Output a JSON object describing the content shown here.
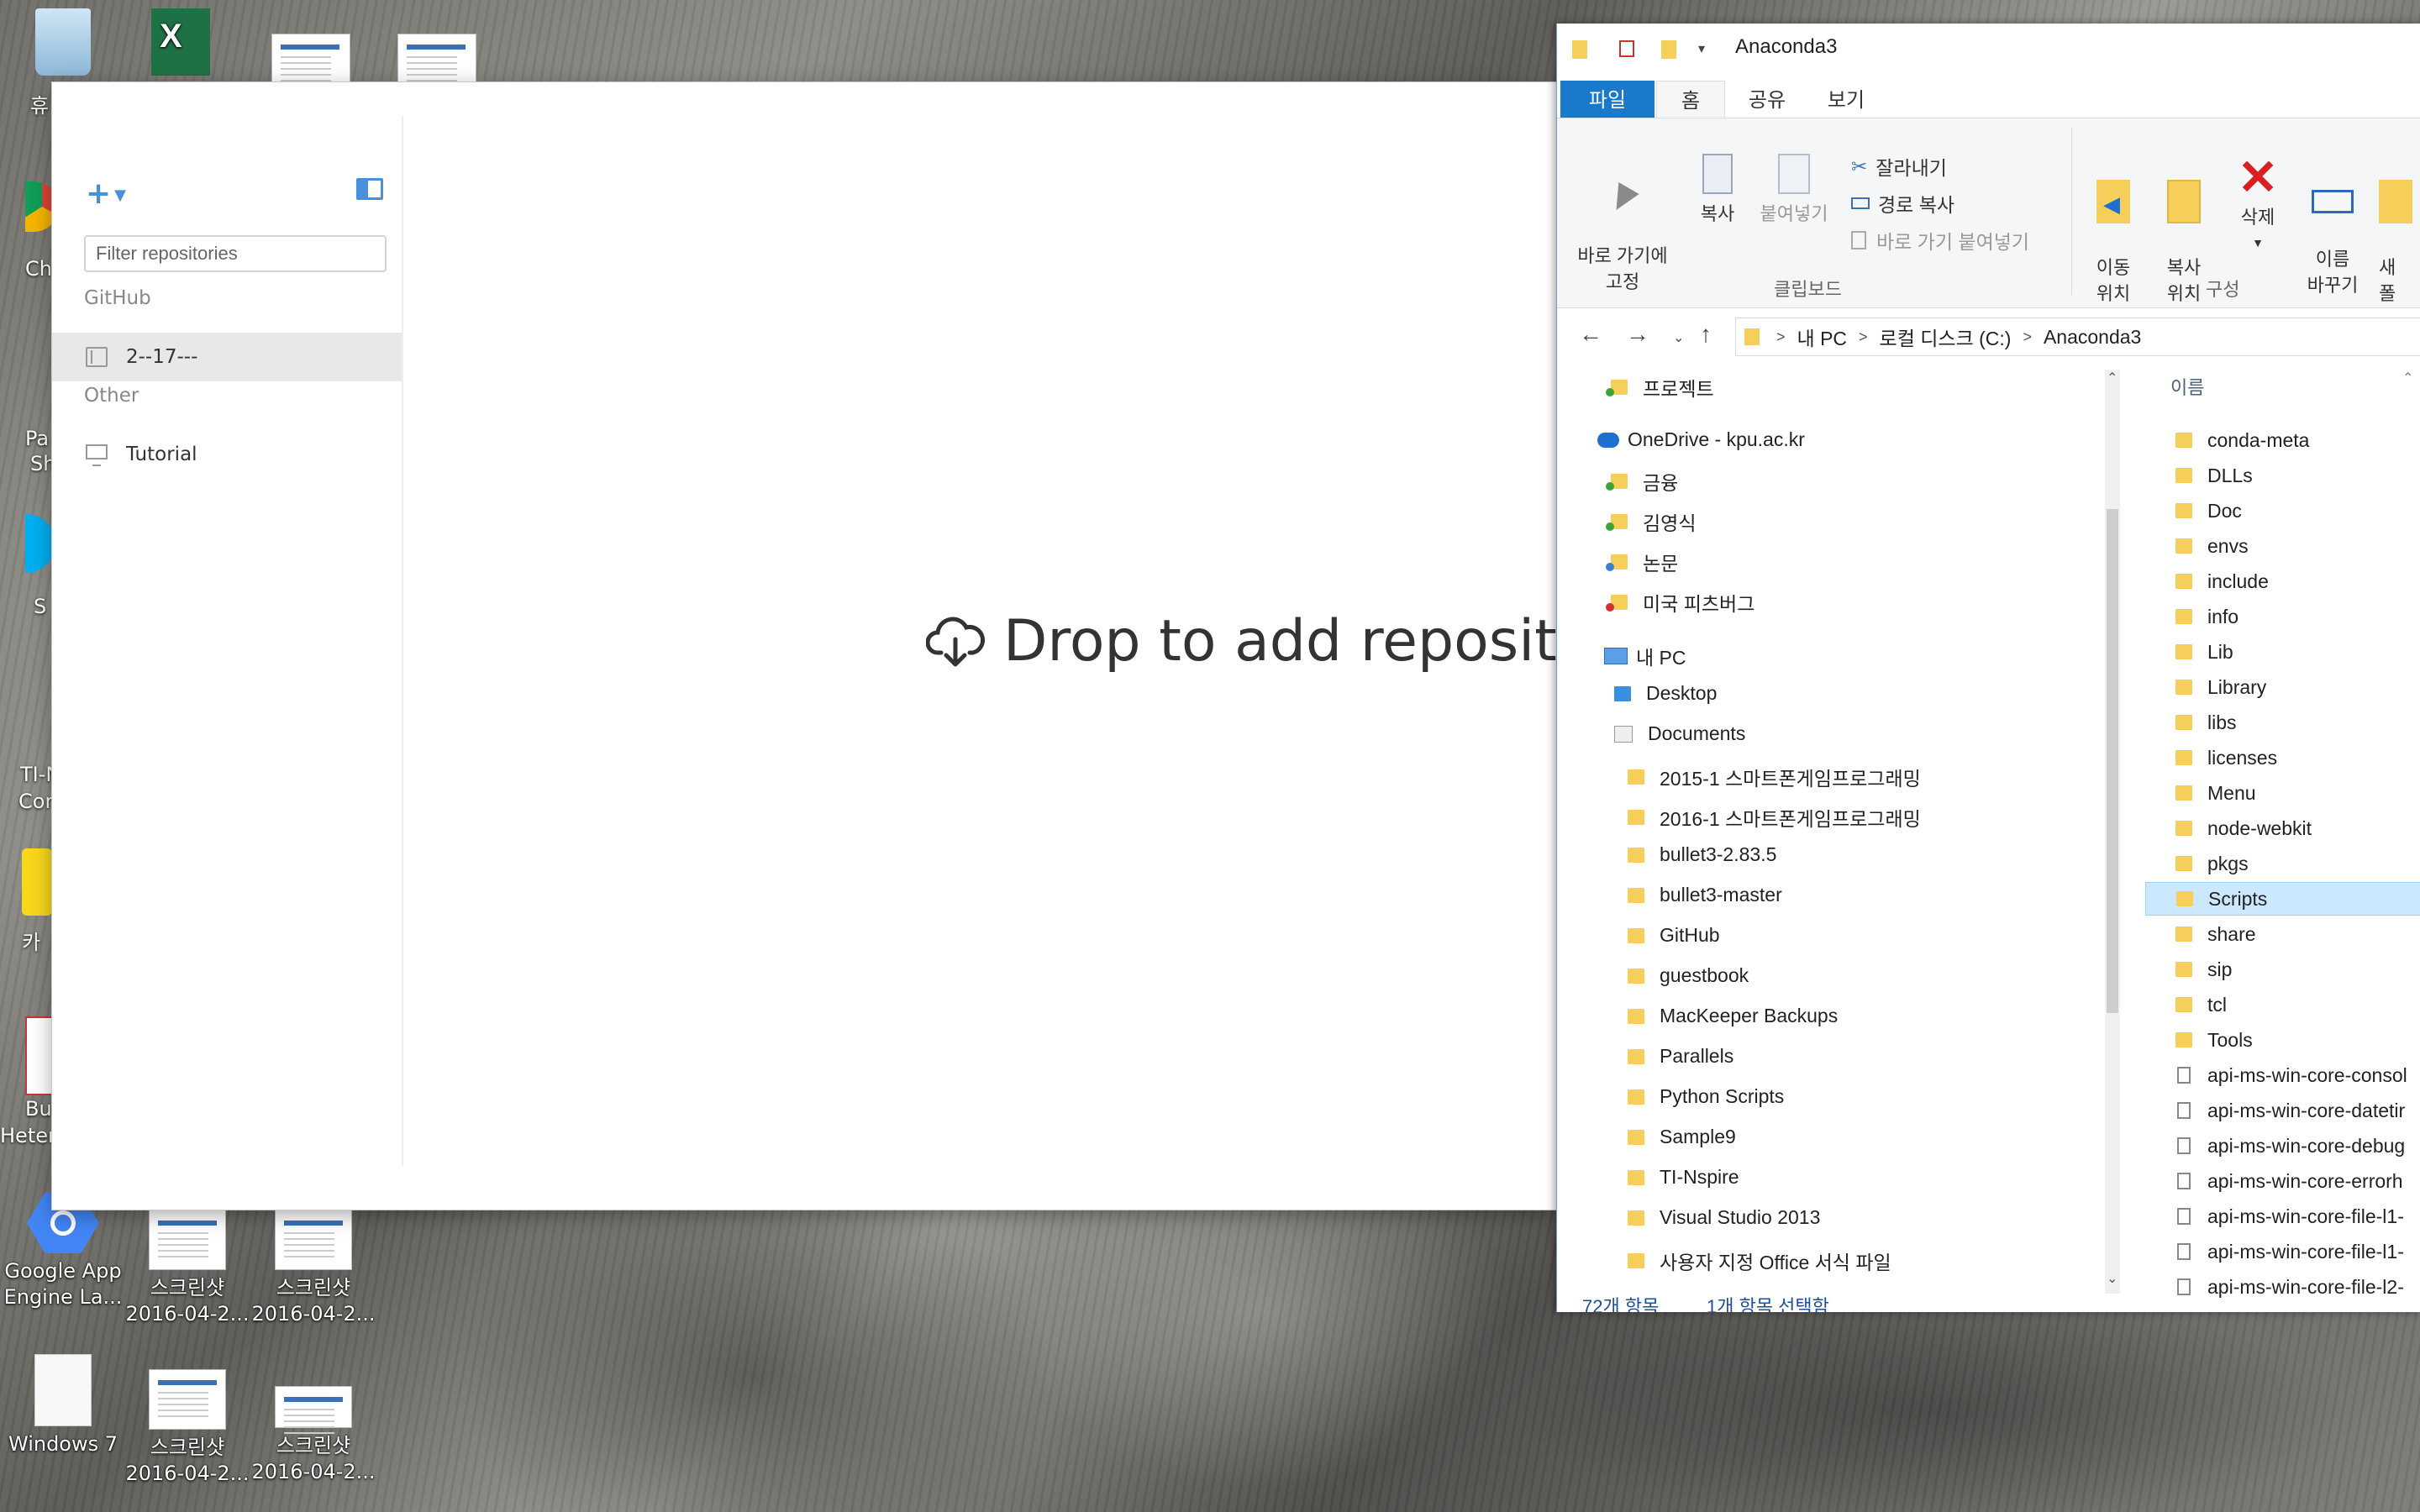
{
  "desktop": {
    "icons": [
      {
        "label": "Google App Engine La..."
      },
      {
        "label": "스크린샷 2016-04-2..."
      },
      {
        "label": "스크린샷 2016-04-2..."
      },
      {
        "label": "Windows 7"
      },
      {
        "label": "스크린샷 2016-04-2..."
      },
      {
        "label": "스크린샷 2016-04-2..."
      }
    ],
    "left_clipped_labels": [
      "휴",
      "Ch",
      "Pa",
      "Sh",
      "S",
      "TI-N",
      "Cor",
      "카",
      "Bu",
      "Heter"
    ]
  },
  "github": {
    "filter_placeholder": "Filter repositories",
    "sections": [
      {
        "title": "GitHub",
        "items": [
          {
            "label": "2--17---",
            "selected": true
          }
        ]
      },
      {
        "title": "Other",
        "items": [
          {
            "label": "Tutorial",
            "selected": false
          }
        ]
      }
    ],
    "drop_text": "Drop to add repositor"
  },
  "explorer": {
    "title": "Anaconda3",
    "tabs": [
      "파일",
      "홈",
      "공유",
      "보기"
    ],
    "ribbon": {
      "pin": "바로 가기에\n고정",
      "copy": "복사",
      "paste": "붙여넣기",
      "cut": "잘라내기",
      "copy_path": "경로 복사",
      "paste_shortcut": "바로 가기 붙여넣기",
      "group_clipboard": "클립보드",
      "move_to": "이동\n위치",
      "copy_to": "복사\n위치",
      "delete": "삭제",
      "rename": "이름\n바꾸기",
      "group_organize": "구성",
      "new_folder_clip": "새\n폴"
    },
    "path": [
      "내 PC",
      "로컬 디스크 (C:)",
      "Anaconda3"
    ],
    "nav_tree": [
      {
        "label": "프로젝트",
        "level": 1,
        "status": "g"
      },
      {
        "label": "OneDrive - kpu.ac.kr",
        "level": 0,
        "icon": "cloud"
      },
      {
        "label": "금융",
        "level": 1,
        "status": "g"
      },
      {
        "label": "김영식",
        "level": 1,
        "status": "g"
      },
      {
        "label": "논문",
        "level": 1,
        "status": "b"
      },
      {
        "label": "미국 피츠버그",
        "level": 1,
        "status": "r"
      },
      {
        "label": "내 PC",
        "level": 0,
        "icon": "pc"
      },
      {
        "label": "Desktop",
        "level": 1,
        "icon": "blue"
      },
      {
        "label": "Documents",
        "level": 1
      },
      {
        "label": "2015-1 스마트폰게임프로그래밍",
        "level": 2
      },
      {
        "label": "2016-1 스마트폰게임프로그래밍",
        "level": 2
      },
      {
        "label": "bullet3-2.83.5",
        "level": 2
      },
      {
        "label": "bullet3-master",
        "level": 2
      },
      {
        "label": "GitHub",
        "level": 2
      },
      {
        "label": "guestbook",
        "level": 2
      },
      {
        "label": "MacKeeper Backups",
        "level": 2
      },
      {
        "label": "Parallels",
        "level": 2
      },
      {
        "label": "Python Scripts",
        "level": 2
      },
      {
        "label": "Sample9",
        "level": 2
      },
      {
        "label": "TI-Nspire",
        "level": 2
      },
      {
        "label": "Visual Studio 2013",
        "level": 2
      },
      {
        "label": "사용자 지정 Office 서식 파일",
        "level": 2
      }
    ],
    "column_name": "이름",
    "files": [
      {
        "name": "conda-meta",
        "type": "folder"
      },
      {
        "name": "DLLs",
        "type": "folder"
      },
      {
        "name": "Doc",
        "type": "folder"
      },
      {
        "name": "envs",
        "type": "folder"
      },
      {
        "name": "include",
        "type": "folder"
      },
      {
        "name": "info",
        "type": "folder"
      },
      {
        "name": "Lib",
        "type": "folder"
      },
      {
        "name": "Library",
        "type": "folder"
      },
      {
        "name": "libs",
        "type": "folder"
      },
      {
        "name": "licenses",
        "type": "folder"
      },
      {
        "name": "Menu",
        "type": "folder"
      },
      {
        "name": "node-webkit",
        "type": "folder"
      },
      {
        "name": "pkgs",
        "type": "folder"
      },
      {
        "name": "Scripts",
        "type": "folder",
        "selected": true
      },
      {
        "name": "share",
        "type": "folder"
      },
      {
        "name": "sip",
        "type": "folder"
      },
      {
        "name": "tcl",
        "type": "folder"
      },
      {
        "name": "Tools",
        "type": "folder"
      },
      {
        "name": "api-ms-win-core-consol",
        "type": "dll"
      },
      {
        "name": "api-ms-win-core-datetir",
        "type": "dll"
      },
      {
        "name": "api-ms-win-core-debug",
        "type": "dll"
      },
      {
        "name": "api-ms-win-core-errorh",
        "type": "dll"
      },
      {
        "name": "api-ms-win-core-file-l1-",
        "type": "dll"
      },
      {
        "name": "api-ms-win-core-file-l1-",
        "type": "dll"
      },
      {
        "name": "api-ms-win-core-file-l2-",
        "type": "dll"
      }
    ],
    "status_items": "72개 항목",
    "status_selected": "1개 항목 선택함"
  }
}
